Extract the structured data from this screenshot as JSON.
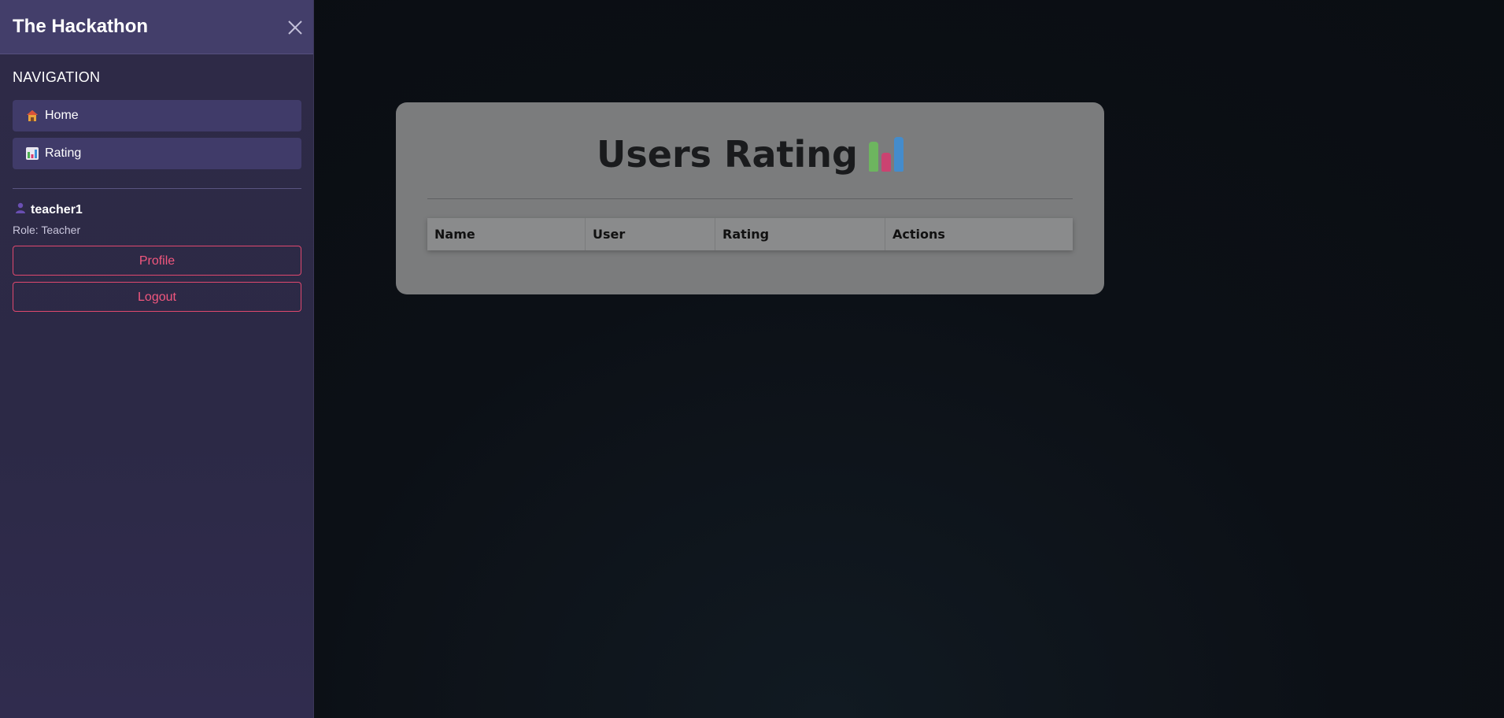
{
  "sidebar": {
    "brand": "The Hackathon",
    "nav_heading": "NAVIGATION",
    "items": [
      {
        "label": "Home",
        "icon": "house-icon"
      },
      {
        "label": "Rating",
        "icon": "bar-chart-icon"
      }
    ],
    "user": {
      "icon": "user-silhouette-icon",
      "username": "teacher1",
      "role": "Role: Teacher"
    },
    "profile_label": "Profile",
    "logout_label": "Logout"
  },
  "main": {
    "title": "Users Rating",
    "title_icon": "bar-chart-icon",
    "table": {
      "headers": [
        "Name",
        "User",
        "Rating",
        "Actions"
      ]
    }
  },
  "colors": {
    "sidebar_bg": "#2e2a47",
    "sidebar_header_bg": "#433e6a",
    "nav_item_bg": "#403b69",
    "accent_pink": "#f2577e",
    "page_bg": "#0a0d12",
    "card_bg_dimmed": "#7b7c7d"
  }
}
